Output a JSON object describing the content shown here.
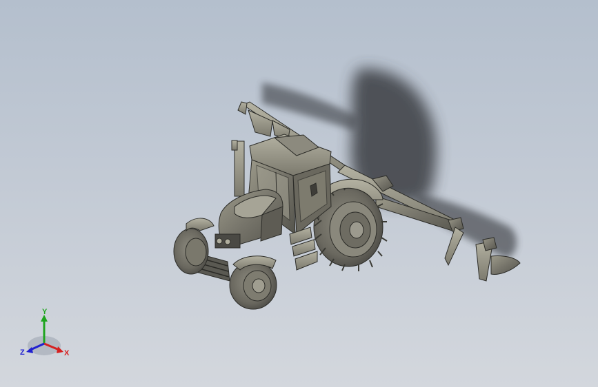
{
  "viewport": {
    "background_top": "#b4bfcd",
    "background_bottom": "#d3d7dd",
    "model": "tractor-with-plow-assembly",
    "shaded_with_edges": true,
    "shadow": true
  },
  "triad": {
    "x_label": "X",
    "y_label": "Y",
    "z_label": "Z",
    "x_color": "#d62020",
    "y_color": "#1fa51f",
    "z_color": "#2020d0"
  }
}
